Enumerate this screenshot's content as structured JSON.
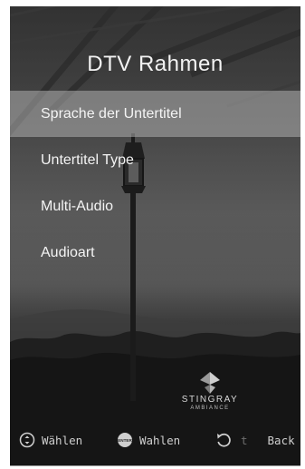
{
  "title": "DTV Rahmen",
  "menu": {
    "items": [
      {
        "label": "Sprache der Untertitel",
        "selected": true
      },
      {
        "label": "Untertitel Type",
        "selected": false
      },
      {
        "label": "Multi-Audio",
        "selected": false
      },
      {
        "label": "Audioart",
        "selected": false
      }
    ]
  },
  "brand": {
    "name": "STINGRAY",
    "subtitle": "AMBIANCE"
  },
  "hints": {
    "updown_label": "Wählen",
    "enter_icon_text": "ENTER",
    "enter_label": "Wahlen",
    "back_hidden_label": "t",
    "back_label": "Back"
  }
}
